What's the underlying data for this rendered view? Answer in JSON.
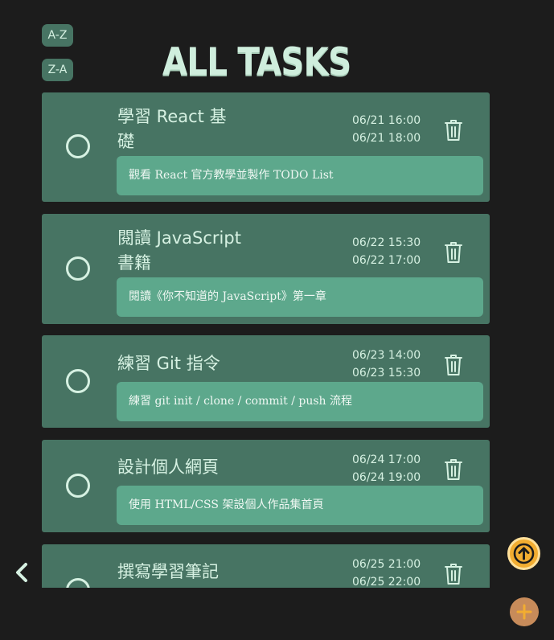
{
  "sort": {
    "az_label": "A-Z",
    "za_label": "Z-A"
  },
  "header": {
    "title": "ALL TASKS"
  },
  "tasks": [
    {
      "name_line1": "學習 React 基",
      "name_line2": "礎",
      "start": "06/21 16:00",
      "end": "06/21 18:00",
      "description": "觀看 React 官方教學並製作 TODO List",
      "completed": false
    },
    {
      "name_line1": "閱讀 JavaScript",
      "name_line2": "書籍",
      "start": "06/22 15:30",
      "end": "06/22 17:00",
      "description": "閱讀《你不知道的 JavaScript》第一章",
      "completed": false
    },
    {
      "name_line1": "練習 Git 指令",
      "name_line2": "",
      "start": "06/23 14:00",
      "end": "06/23 15:30",
      "description": "練習 git init / clone / commit / push 流程",
      "completed": false
    },
    {
      "name_line1": "設計個人網頁",
      "name_line2": "",
      "start": "06/24 17:00",
      "end": "06/24 19:00",
      "description": "使用 HTML/CSS 架設個人作品集首頁",
      "completed": false
    },
    {
      "name_line1": "撰寫學習筆記",
      "name_line2": "",
      "start": "06/25 21:00",
      "end": "06/25 22:00",
      "description": "",
      "completed": false
    }
  ],
  "icons": {
    "complete": "circle-check-icon",
    "delete": "trash-icon",
    "back": "chevron-left-icon",
    "scroll_top": "arrow-up-icon",
    "add": "plus-icon"
  },
  "colors": {
    "background": "#1c1c1c",
    "card": "#477463",
    "description": "#5da88c",
    "text": "#d6f1e2",
    "scroll_top_button": "#f2ad31",
    "add_button": "#c78b5a"
  }
}
